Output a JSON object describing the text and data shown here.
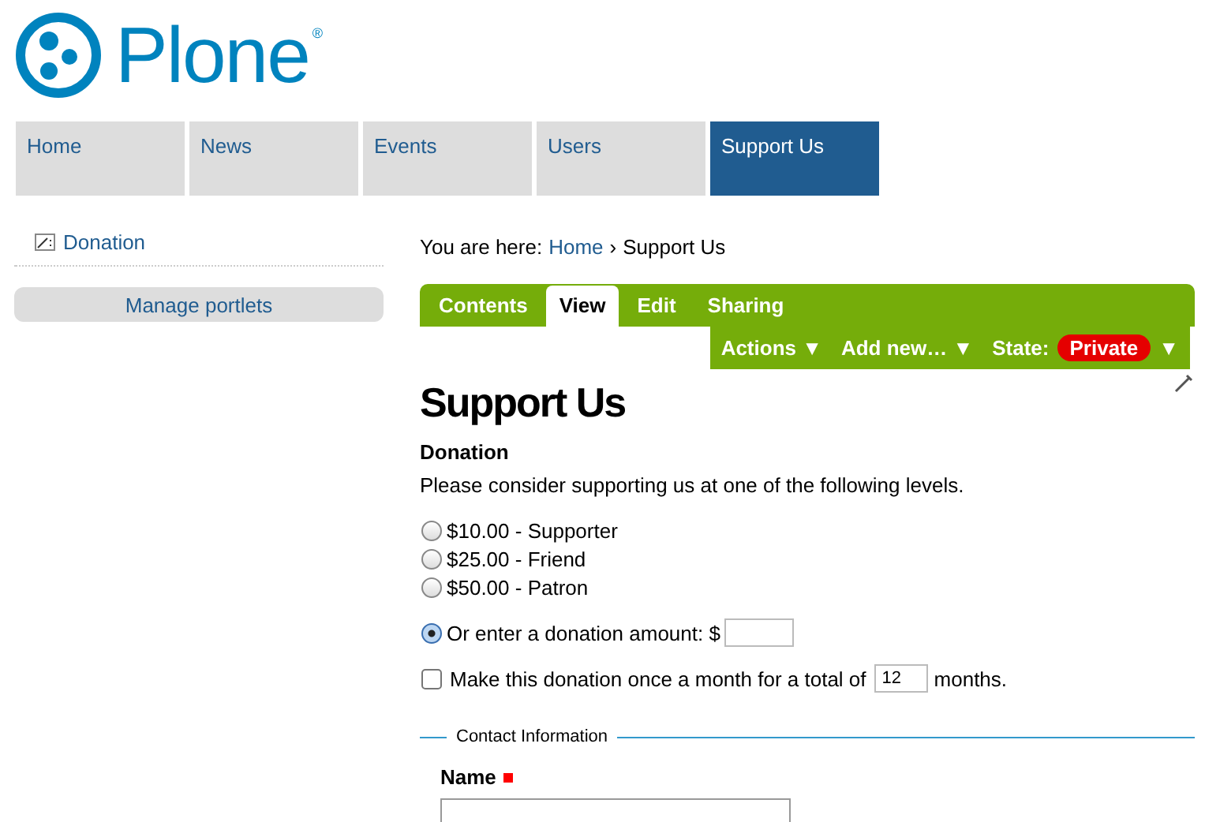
{
  "logo": {
    "name": "Plone",
    "mark": "®"
  },
  "nav": [
    {
      "label": "Home",
      "selected": false
    },
    {
      "label": "News",
      "selected": false
    },
    {
      "label": "Events",
      "selected": false
    },
    {
      "label": "Users",
      "selected": false
    },
    {
      "label": "Support Us",
      "selected": true
    }
  ],
  "sidebar": {
    "items": [
      {
        "label": "Donation"
      }
    ],
    "manage_button": "Manage portlets"
  },
  "breadcrumb": {
    "prefix": "You are here:",
    "links": [
      "Home"
    ],
    "separator": "›",
    "current": "Support Us"
  },
  "edit_tabs": [
    {
      "label": "Contents",
      "selected": false
    },
    {
      "label": "View",
      "selected": true
    },
    {
      "label": "Edit",
      "selected": false
    },
    {
      "label": "Sharing",
      "selected": false
    }
  ],
  "actions": {
    "menus": [
      "Actions ▼",
      "Add new… ▼"
    ],
    "state_label": "State:",
    "state": "Private",
    "state_arrow": "▼"
  },
  "title": "Support Us",
  "form": {
    "section": "Donation",
    "description": "Please consider supporting us at one of the following levels.",
    "levels": [
      {
        "label": "$10.00 - Supporter",
        "selected": false
      },
      {
        "label": "$25.00 - Friend",
        "selected": false
      },
      {
        "label": "$50.00 - Patron",
        "selected": false
      }
    ],
    "custom": {
      "label": "Or enter a donation amount: $",
      "selected": true
    },
    "recurring": {
      "checked": false,
      "before": "Make this donation once a month for a total of",
      "value": "12",
      "after": "months."
    },
    "fieldset": "Contact Information",
    "name_label": "Name",
    "name_required": true
  }
}
